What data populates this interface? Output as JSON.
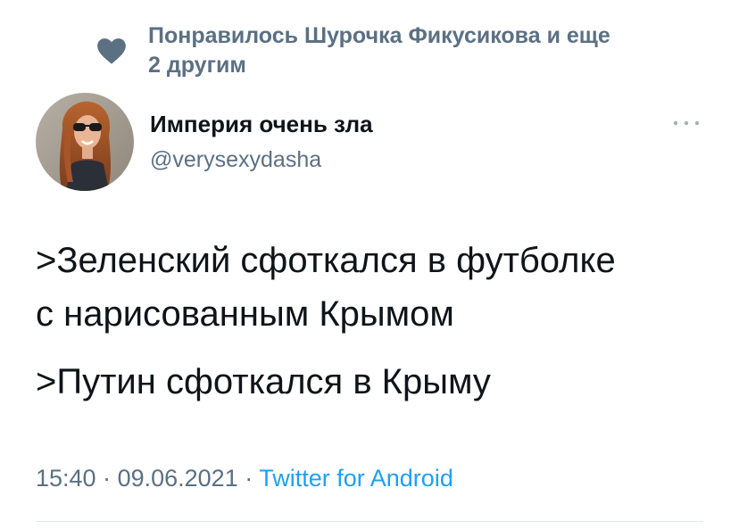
{
  "liked_by": {
    "text_line1": "Понравилось Шурочка Фикусикова и еще",
    "text_line2": "2 другим",
    "icon": "heart-icon"
  },
  "author": {
    "display_name": "Империя очень зла",
    "handle": "@verysexydasha",
    "avatar": "avatar"
  },
  "menu": {
    "icon": "more-horizontal-icon"
  },
  "tweet": {
    "lines": [
      ">Зеленский сфоткался в футболке",
      "с нарисованным Крымом",
      ">Путин сфоткался в Крыму"
    ]
  },
  "meta": {
    "time": "15:40",
    "separator1": " · ",
    "date": "09.06.2021",
    "separator2": " · ",
    "source": "Twitter for Android"
  },
  "colors": {
    "secondary_text": "#5b7083",
    "link": "#1da1f2",
    "primary_text": "#0f1419",
    "divider": "#e1e8ed"
  }
}
